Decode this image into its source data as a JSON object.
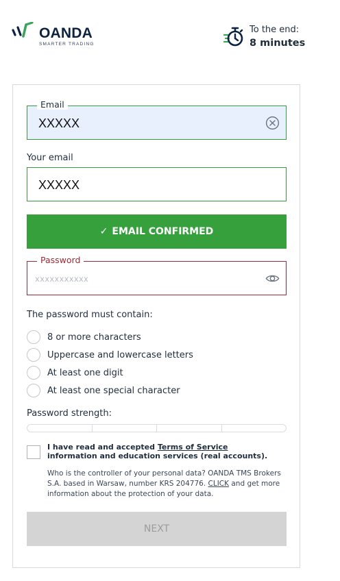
{
  "brand": {
    "name": "OANDA",
    "tagline": "SMARTER TRADING"
  },
  "timer": {
    "label": "To the end:",
    "value": "8 minutes"
  },
  "email_field": {
    "label": "Email",
    "value": "XXXXX"
  },
  "your_email": {
    "label": "Your email",
    "value": "XXXXX"
  },
  "confirm_button": {
    "label": "EMAIL CONFIRMED",
    "icon": "check"
  },
  "password_field": {
    "label": "Password",
    "placeholder": "xxxxxxxxxxx"
  },
  "requirements": {
    "title": "The password must contain:",
    "items": [
      {
        "label": "8 or more characters"
      },
      {
        "label": "Uppercase and lowercase letters"
      },
      {
        "label": "At least one digit"
      },
      {
        "label": "At least one special character"
      }
    ]
  },
  "strength": {
    "label": "Password strength:",
    "segments": 4,
    "filled": 0
  },
  "terms": {
    "before": "I have read and accepted ",
    "link": "Terms of Service",
    "after": " information and education services (real accounts)."
  },
  "privacy": {
    "before": "Who is the controller of your personal data? OANDA TMS Brokers S.A. based in Warsaw, number KRS 204776. ",
    "link": "CLICK",
    "after": " and get more information about the protection of your data."
  },
  "next_button": {
    "label": "NEXT"
  },
  "colors": {
    "brand_green": "#36a03d",
    "navy": "#0b2340",
    "error": "#9a2a36",
    "disabled": "#d4d4d4"
  }
}
